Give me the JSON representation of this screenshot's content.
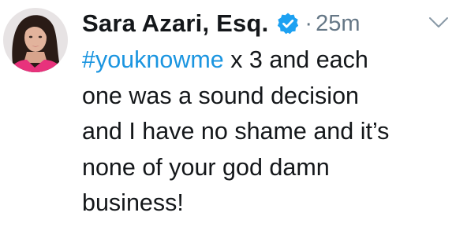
{
  "tweet": {
    "author_name": "Sara Azari, Esq.",
    "verified_icon": "verified-badge-icon",
    "separator": "·",
    "timestamp": "25m",
    "menu_icon": "chevron-down-icon",
    "hashtag": "#youknowme",
    "lines": [
      " x 3 and each",
      "one was a sound decision",
      "and I have no shame and it’s",
      "none of your god damn",
      "business!"
    ]
  },
  "colors": {
    "text": "#14171a",
    "muted": "#657786",
    "accent": "#1b95e0",
    "verified": "#1da1f2"
  }
}
